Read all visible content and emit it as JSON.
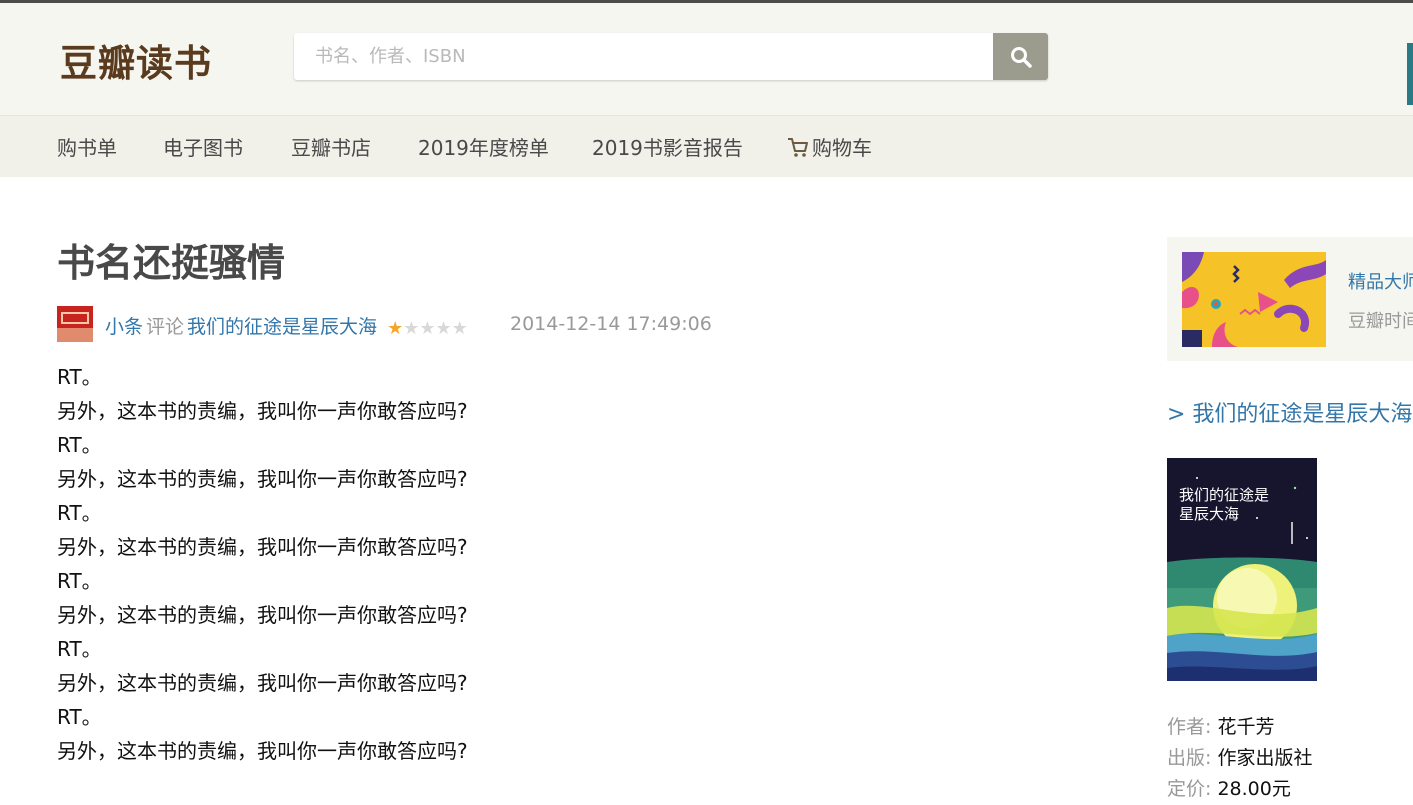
{
  "header": {
    "logo": "豆瓣读书",
    "search_placeholder": "书名、作者、ISBN",
    "search_value": ""
  },
  "nav": {
    "items": [
      "购书单",
      "电子图书",
      "豆瓣书店",
      "2019年度榜单",
      "2019书影音报告",
      "购物车"
    ]
  },
  "review": {
    "title": "书名还挺骚情",
    "user": "小条",
    "action": "评论",
    "book": "我们的征途是星辰大海",
    "rating": 1,
    "rating_max": 5,
    "date": "2014-12-14 17:49:06",
    "lines": [
      "RT。",
      "另外，这本书的责编，我叫你一声你敢答应吗?",
      "RT。",
      "另外，这本书的责编，我叫你一声你敢答应吗?",
      "RT。",
      "另外，这本书的责编，我叫你一声你敢答应吗?",
      "RT。",
      "另外，这本书的责编，我叫你一声你敢答应吗?",
      "RT。",
      "另外，这本书的责编，我叫你一声你敢答应吗?",
      "RT。",
      "另外，这本书的责编，我叫你一声你敢答应吗?"
    ]
  },
  "sidebar": {
    "ad_title": "精品大师",
    "ad_subtitle": "豆瓣时间",
    "book_link": "> 我们的征途是星辰大海",
    "cover_title": "我们的征途是星辰大海",
    "info": [
      {
        "key": "作者:",
        "value": "花千芳"
      },
      {
        "key": "出版:",
        "value": "作家出版社"
      },
      {
        "key": "定价:",
        "value": "28.00元"
      }
    ]
  },
  "colors": {
    "header_bg": "#f6f6f1",
    "nav_bg": "#f1f1ea",
    "logo": "#5a3b1e",
    "link": "#3377aa",
    "star": "#f3a72a"
  }
}
